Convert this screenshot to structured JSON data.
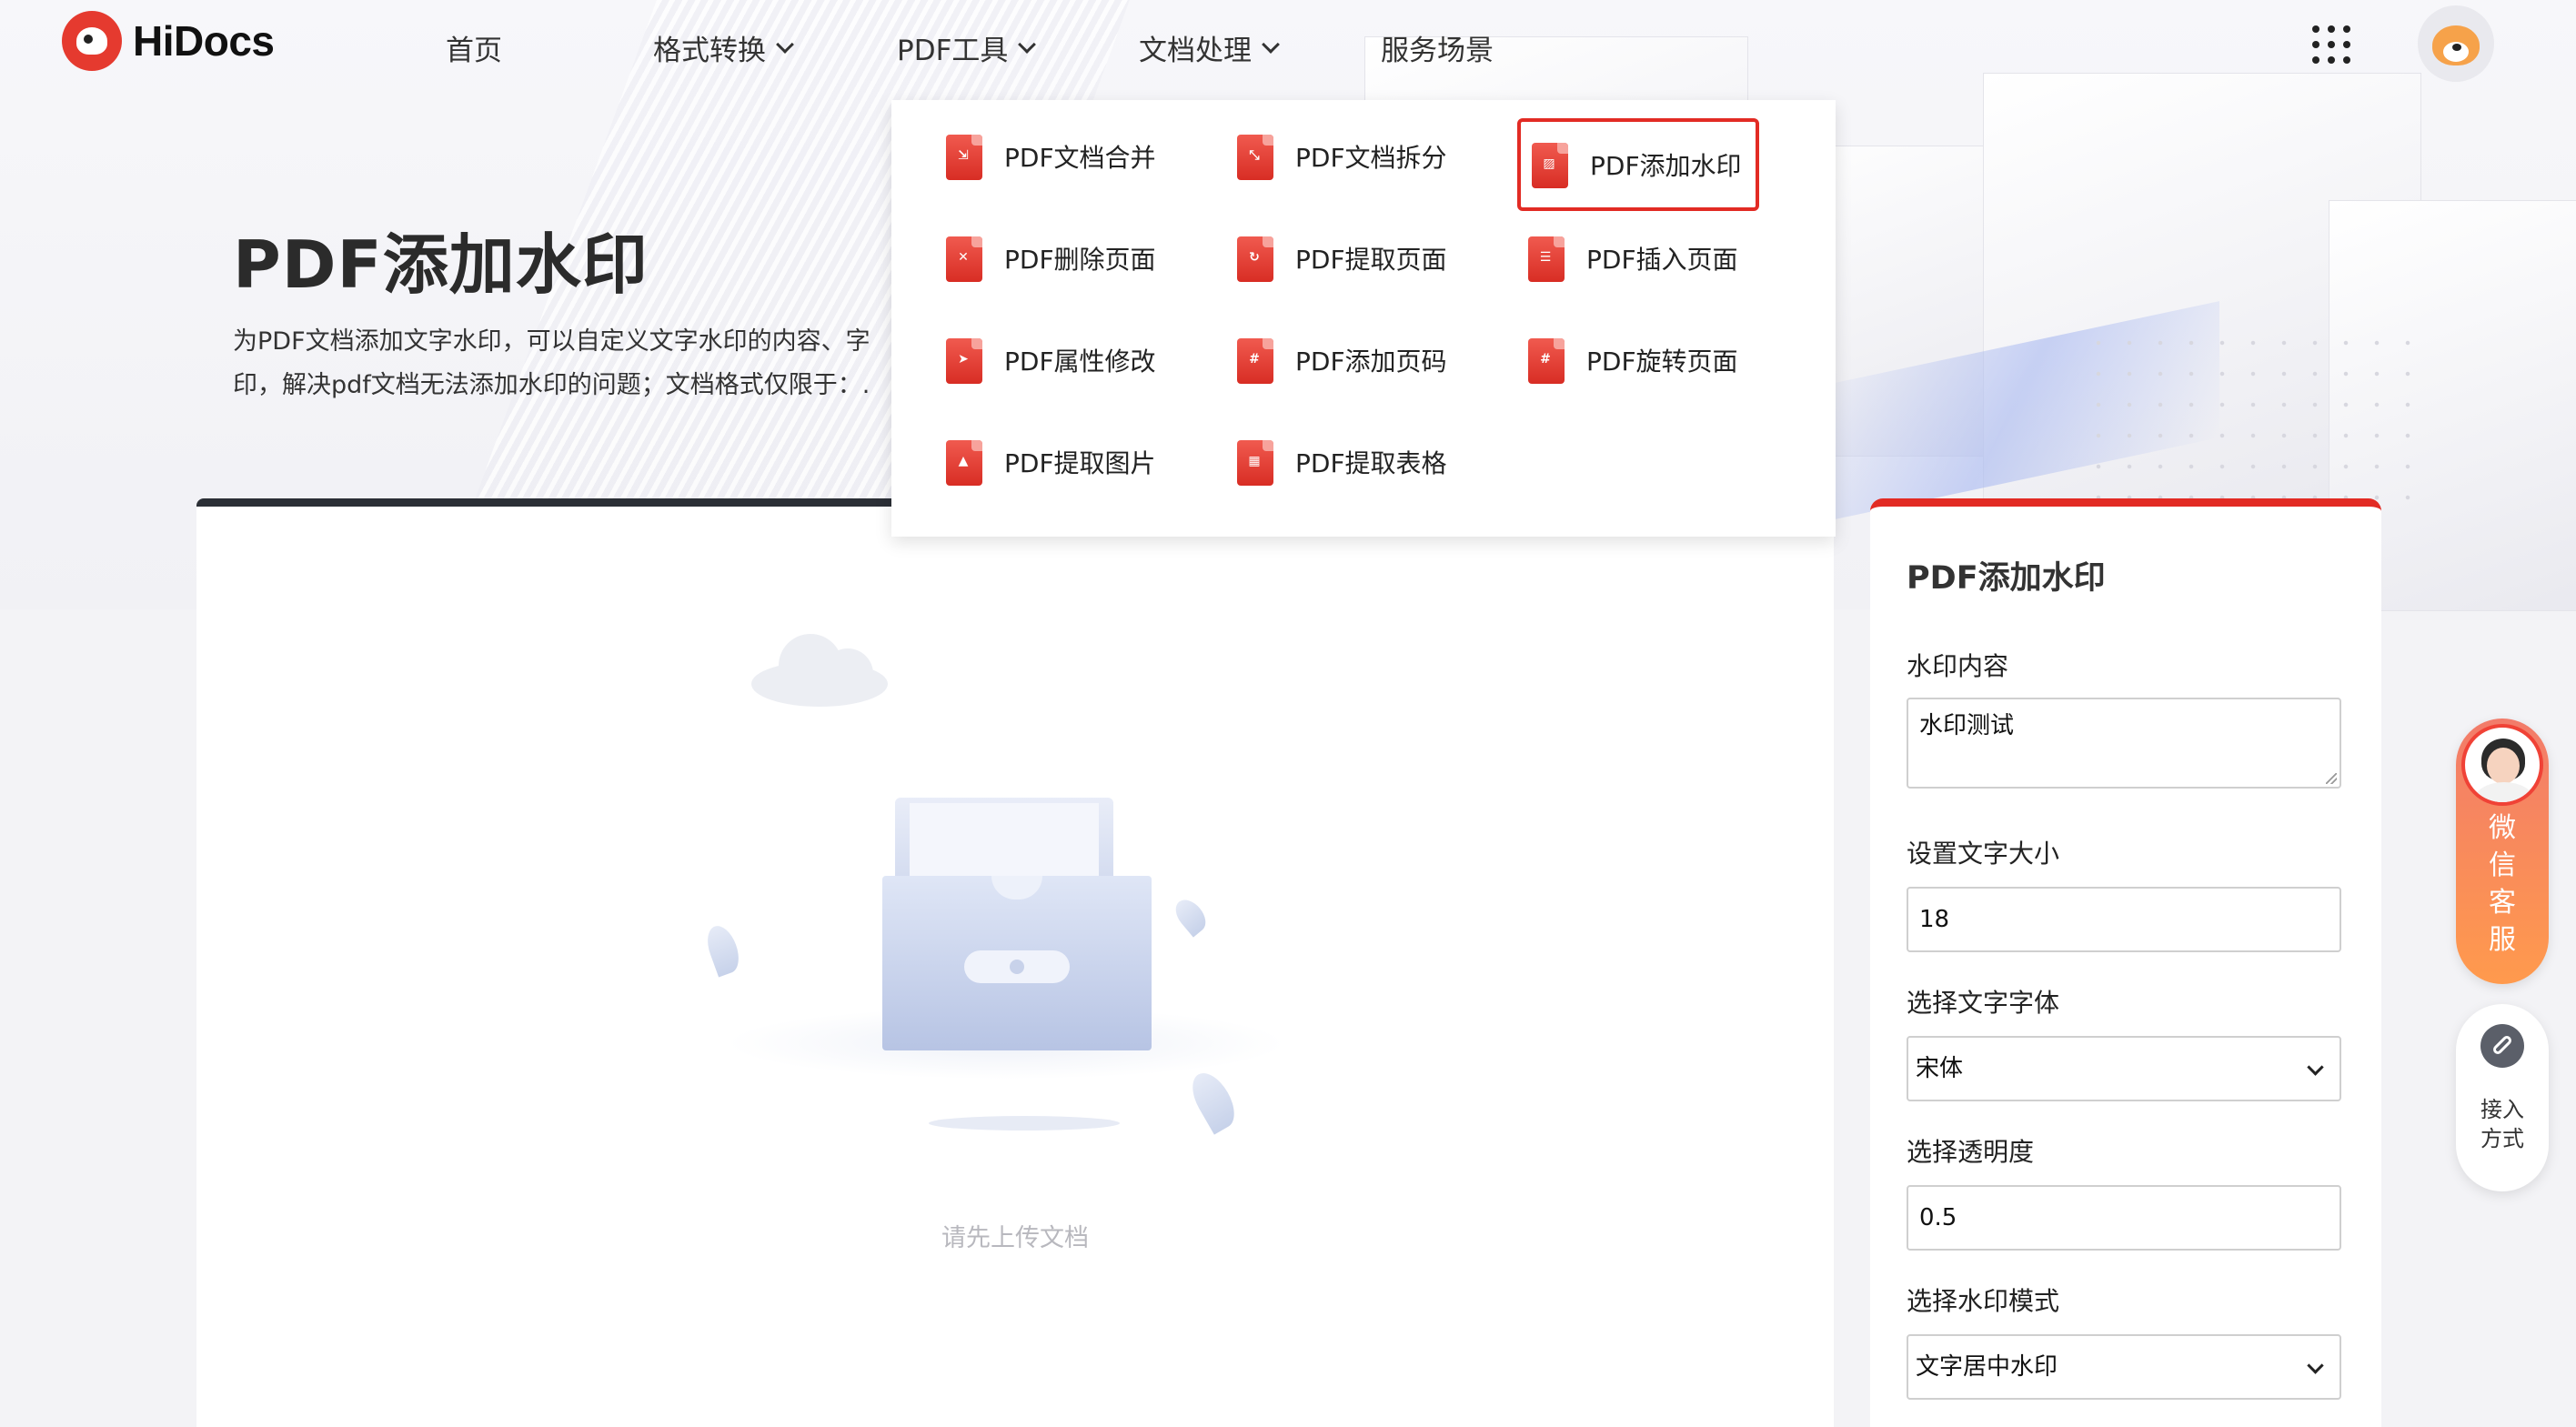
{
  "header": {
    "logo_text": "HiDocs",
    "nav": [
      {
        "label": "首页"
      },
      {
        "label": "格式转换"
      },
      {
        "label": "PDF工具"
      },
      {
        "label": "文档处理"
      },
      {
        "label": "服务场景"
      }
    ]
  },
  "page": {
    "title": "PDF添加水印",
    "desc_line1": "为PDF文档添加文字水印，可以自定义文字水印的内容、字",
    "desc_line2": "印，解决pdf文档无法添加水印的问题；文档格式仅限于：."
  },
  "dropdown": {
    "items": [
      {
        "label": "PDF文档合并",
        "icon": "merge-icon",
        "mark": "⇲"
      },
      {
        "label": "PDF文档拆分",
        "icon": "split-icon",
        "mark": "⤡"
      },
      {
        "label": "PDF添加水印",
        "icon": "watermark-icon",
        "mark": "▨",
        "active": true
      },
      {
        "label": "PDF删除页面",
        "icon": "delete-page-icon",
        "mark": "✕"
      },
      {
        "label": "PDF提取页面",
        "icon": "extract-page-icon",
        "mark": "↻"
      },
      {
        "label": "PDF插入页面",
        "icon": "insert-page-icon",
        "mark": "☰"
      },
      {
        "label": "PDF属性修改",
        "icon": "properties-icon",
        "mark": "➤"
      },
      {
        "label": "PDF添加页码",
        "icon": "page-number-icon",
        "mark": "#"
      },
      {
        "label": "PDF旋转页面",
        "icon": "rotate-page-icon",
        "mark": "#"
      },
      {
        "label": "PDF提取图片",
        "icon": "extract-image-icon",
        "mark": "▲"
      },
      {
        "label": "PDF提取表格",
        "icon": "extract-table-icon",
        "mark": "▦"
      }
    ]
  },
  "upload": {
    "empty_text": "请先上传文档"
  },
  "panel": {
    "title": "PDF添加水印",
    "content_label": "水印内容",
    "content_value": "水印测试",
    "size_label": "设置文字大小",
    "size_value": "18",
    "font_label": "选择文字字体",
    "font_value": "宋体",
    "opacity_label": "选择透明度",
    "opacity_value": "0.5",
    "mode_label": "选择水印模式",
    "mode_value": "文字居中水印"
  },
  "widgets": {
    "service_label": "微\n信\n客\n服",
    "access_label": "接入\n方式"
  },
  "colors": {
    "accent": "#e22b24",
    "upload_border": "#2b2f36"
  }
}
